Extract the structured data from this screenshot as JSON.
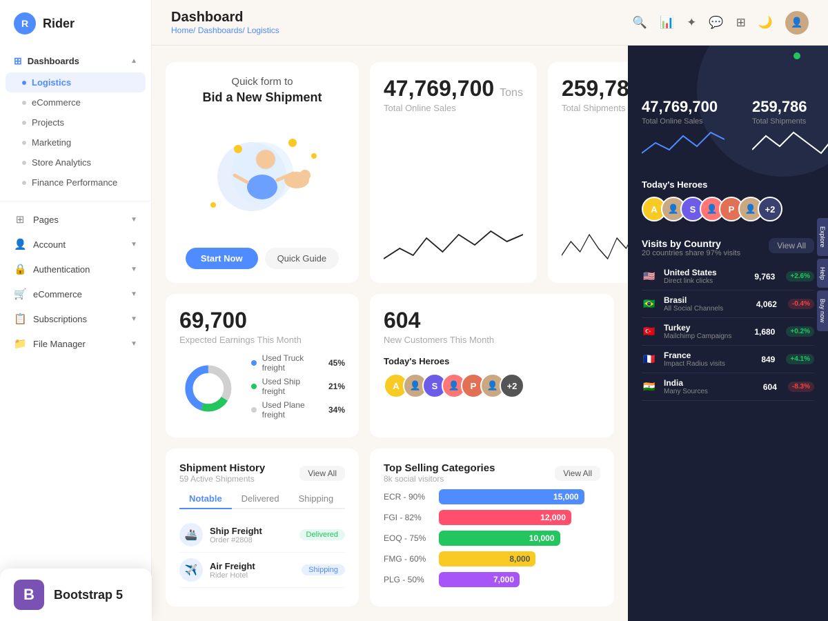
{
  "app": {
    "logo_letter": "R",
    "logo_name": "Rider"
  },
  "sidebar": {
    "dashboards_label": "Dashboards",
    "items": [
      {
        "label": "Logistics",
        "active": true
      },
      {
        "label": "eCommerce",
        "active": false
      },
      {
        "label": "Projects",
        "active": false
      },
      {
        "label": "Marketing",
        "active": false
      },
      {
        "label": "Store Analytics",
        "active": false
      },
      {
        "label": "Finance Performance",
        "active": false
      }
    ],
    "pages": [
      {
        "label": "Pages",
        "icon": "⊞",
        "has_chevron": true
      },
      {
        "label": "Account",
        "icon": "👤",
        "has_chevron": true
      },
      {
        "label": "Authentication",
        "icon": "🔒",
        "has_chevron": true
      },
      {
        "label": "eCommerce",
        "icon": "🛒",
        "has_chevron": true
      },
      {
        "label": "Subscriptions",
        "icon": "📋",
        "has_chevron": true
      },
      {
        "label": "File Manager",
        "icon": "📁",
        "has_chevron": true
      }
    ]
  },
  "header": {
    "title": "Dashboard",
    "breadcrumb_home": "Home/",
    "breadcrumb_dashboards": "Dashboards/",
    "breadcrumb_current": "Logistics"
  },
  "quick_form": {
    "title": "Quick form to",
    "subtitle": "Bid a New Shipment",
    "btn_start": "Start Now",
    "btn_guide": "Quick Guide"
  },
  "stats": {
    "total_sales_number": "47,769,700",
    "total_sales_unit": "Tons",
    "total_sales_label": "Total Online Sales",
    "total_shipments_number": "259,786",
    "total_shipments_label": "Total Shipments",
    "earnings_number": "69,700",
    "earnings_label": "Expected Earnings This Month",
    "customers_number": "604",
    "customers_label": "New Customers This Month"
  },
  "freight": {
    "truck_label": "Used Truck freight",
    "truck_pct": "45%",
    "truck_value": 45,
    "ship_label": "Used Ship freight",
    "ship_pct": "21%",
    "ship_value": 21,
    "plane_label": "Used Plane freight",
    "plane_pct": "34%",
    "plane_value": 34
  },
  "heroes": {
    "title": "Today's Heroes",
    "avatars": [
      {
        "letter": "A",
        "color": "#f9ca24"
      },
      {
        "letter": "S",
        "color": "#6c5ce7"
      },
      {
        "letter": "P",
        "color": "#e17055"
      },
      {
        "letter": "+2",
        "color": "#555"
      }
    ]
  },
  "shipment_history": {
    "title": "Shipment History",
    "subtitle": "59 Active Shipments",
    "view_all": "View All",
    "tabs": [
      "Notable",
      "Delivered",
      "Shipping"
    ],
    "active_tab": "Notable",
    "items": [
      {
        "icon": "🚢",
        "name": "Ship Freight",
        "sub": "Order #2808",
        "badge": "Delivered",
        "badge_type": "green"
      },
      {
        "icon": "✈️",
        "name": "Air Freight",
        "sub": "Rider Hotel",
        "badge": "Shipping",
        "badge_type": "blue"
      }
    ]
  },
  "categories": {
    "title": "Top Selling Categories",
    "subtitle": "8k social visitors",
    "view_all": "View All",
    "items": [
      {
        "label": "ECR - 90%",
        "value": 15000,
        "display": "15,000",
        "color": "#4f8cff",
        "width": "90%"
      },
      {
        "label": "FGI - 82%",
        "value": 12000,
        "display": "12,000",
        "color": "#ff4f6d",
        "width": "82%"
      },
      {
        "label": "EOQ - 75%",
        "value": 10000,
        "display": "10,000",
        "color": "#22c55e",
        "width": "75%"
      },
      {
        "label": "FMG - 60%",
        "value": 8000,
        "display": "8,000",
        "color": "#f9ca24",
        "width": "60%"
      },
      {
        "label": "PLG - 50%",
        "value": 7000,
        "display": "7,000",
        "color": "#a855f7",
        "width": "50%"
      }
    ]
  },
  "right_panel": {
    "labels": [
      "Explore",
      "Help",
      "Buy now"
    ],
    "online_dot": true,
    "visits_title": "Visits by Country",
    "visits_sub": "20 countries share 97% visits",
    "visits_view_all": "View All",
    "countries": [
      {
        "flag": "🇺🇸",
        "name": "United States",
        "sub": "Direct link clicks",
        "visits": "9,763",
        "change": "+2.6%",
        "up": true
      },
      {
        "flag": "🇧🇷",
        "name": "Brasil",
        "sub": "All Social Channels",
        "visits": "4,062",
        "change": "-0.4%",
        "up": false
      },
      {
        "flag": "🇹🇷",
        "name": "Turkey",
        "sub": "Mailchimp Campaigns",
        "visits": "1,680",
        "change": "+0.2%",
        "up": true
      },
      {
        "flag": "🇫🇷",
        "name": "France",
        "sub": "Impact Radius visits",
        "visits": "849",
        "change": "+4.1%",
        "up": true
      },
      {
        "flag": "🇮🇳",
        "name": "India",
        "sub": "Many Sources",
        "visits": "604",
        "change": "-8.3%",
        "up": false
      }
    ]
  },
  "promo": {
    "icon": "B",
    "text": "Bootstrap 5"
  }
}
